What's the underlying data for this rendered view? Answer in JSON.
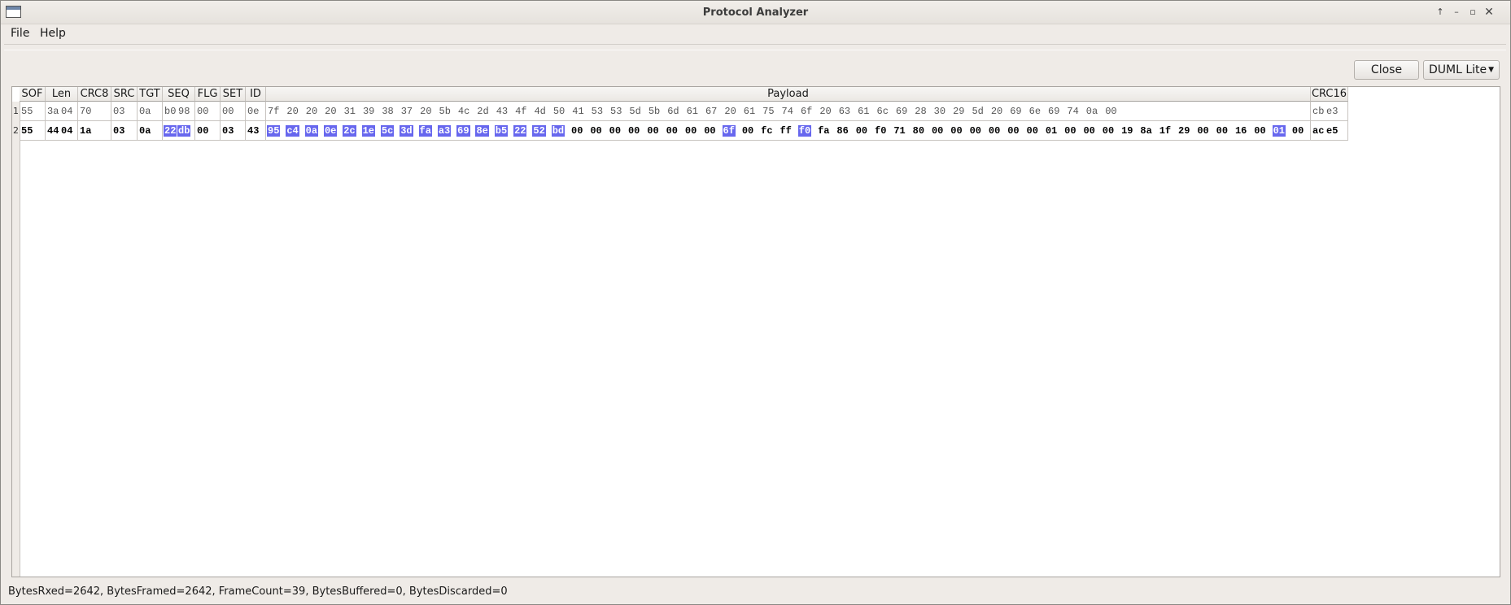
{
  "window": {
    "title": "Protocol Analyzer",
    "controls": [
      "up-arrow-icon",
      "minimize-icon",
      "maximize-icon",
      "close-icon"
    ]
  },
  "menubar": {
    "items": [
      "File",
      "Help"
    ]
  },
  "toolbar": {
    "close_label": "Close",
    "protocol_select": "DUML Lite"
  },
  "table": {
    "columns": [
      "SOF",
      "Len",
      "CRC8",
      "SRC",
      "TGT",
      "SEQ",
      "FLG",
      "SET",
      "ID",
      "Payload",
      "CRC16"
    ],
    "rows": [
      {
        "num": "1",
        "bold": false,
        "sof": [
          "55"
        ],
        "len": [
          "3a",
          "04"
        ],
        "crc8": [
          "70"
        ],
        "src": [
          "03"
        ],
        "tgt": [
          "0a"
        ],
        "seq": [
          "b0",
          "98"
        ],
        "flg": [
          "00"
        ],
        "set": [
          "00"
        ],
        "id": [
          "0e"
        ],
        "payload": [
          "7f",
          "20",
          "20",
          "20",
          "31",
          "39",
          "38",
          "37",
          "20",
          "5b",
          "4c",
          "2d",
          "43",
          "4f",
          "4d",
          "50",
          "41",
          "53",
          "53",
          "5d",
          "5b",
          "6d",
          "61",
          "67",
          "20",
          "61",
          "75",
          "74",
          "6f",
          "20",
          "63",
          "61",
          "6c",
          "69",
          "28",
          "30",
          "29",
          "5d",
          "20",
          "69",
          "6e",
          "69",
          "74",
          "0a",
          "00"
        ],
        "crc16": [
          "cb",
          "e3"
        ]
      },
      {
        "num": "2",
        "bold": true,
        "sof": [
          "55"
        ],
        "len": [
          "44",
          "04"
        ],
        "crc8": [
          "1a"
        ],
        "src": [
          "03"
        ],
        "tgt": [
          "0a"
        ],
        "seq": [
          "22",
          "db"
        ],
        "seq_hl": [
          0,
          1
        ],
        "flg": [
          "00"
        ],
        "set": [
          "03"
        ],
        "id": [
          "43"
        ],
        "payload": [
          "95",
          "c4",
          "0a",
          "0e",
          "2c",
          "1e",
          "5c",
          "3d",
          "fa",
          "a3",
          "69",
          "8e",
          "b5",
          "22",
          "52",
          "bd",
          "00",
          "00",
          "00",
          "00",
          "00",
          "00",
          "00",
          "00",
          "6f",
          "00",
          "fc",
          "ff",
          "f0",
          "fa",
          "86",
          "00",
          "f0",
          "71",
          "80",
          "00",
          "00",
          "00",
          "00",
          "00",
          "00",
          "01",
          "00",
          "00",
          "00",
          "19",
          "8a",
          "1f",
          "29",
          "00",
          "00",
          "16",
          "00",
          "01",
          "00"
        ],
        "payload_hl": [
          0,
          1,
          2,
          3,
          4,
          5,
          6,
          7,
          8,
          9,
          10,
          11,
          12,
          13,
          14,
          15,
          24,
          28,
          53
        ],
        "crc16": [
          "ac",
          "e5"
        ]
      }
    ]
  },
  "status": "BytesRxed=2642, BytesFramed=2642, FrameCount=39, BytesBuffered=0, BytesDiscarded=0"
}
